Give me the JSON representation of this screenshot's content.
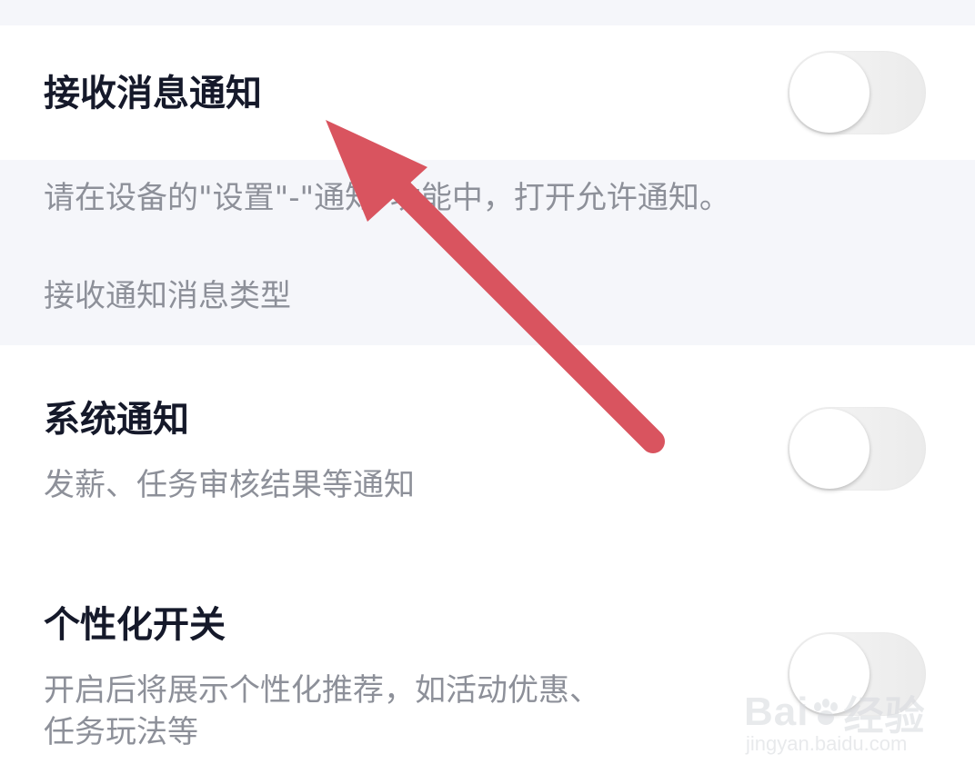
{
  "settings": {
    "receive_notifications": {
      "title": "接收消息通知",
      "enabled": false
    },
    "hint": {
      "device_tip": "请在设备的\"设置\"-\"通知\"功能中，打开允许通知。",
      "section_header": "接收通知消息类型"
    },
    "system_notification": {
      "title": "系统通知",
      "description": "发薪、任务审核结果等通知",
      "enabled": false
    },
    "personalization": {
      "title": "个性化开关",
      "description_line1": "开启后将展示个性化推荐，如活动优惠、",
      "description_line2": "任务玩法等",
      "enabled": false
    }
  },
  "watermark": {
    "brand_left": "Bai",
    "brand_right": "经验",
    "url": "jingyan.baidu.com"
  },
  "colors": {
    "title": "#15192a",
    "subtext": "#8d9099",
    "section_bg": "#f5f6fa",
    "arrow": "#d9545f",
    "toggle_off_track": "#ebebeb"
  }
}
